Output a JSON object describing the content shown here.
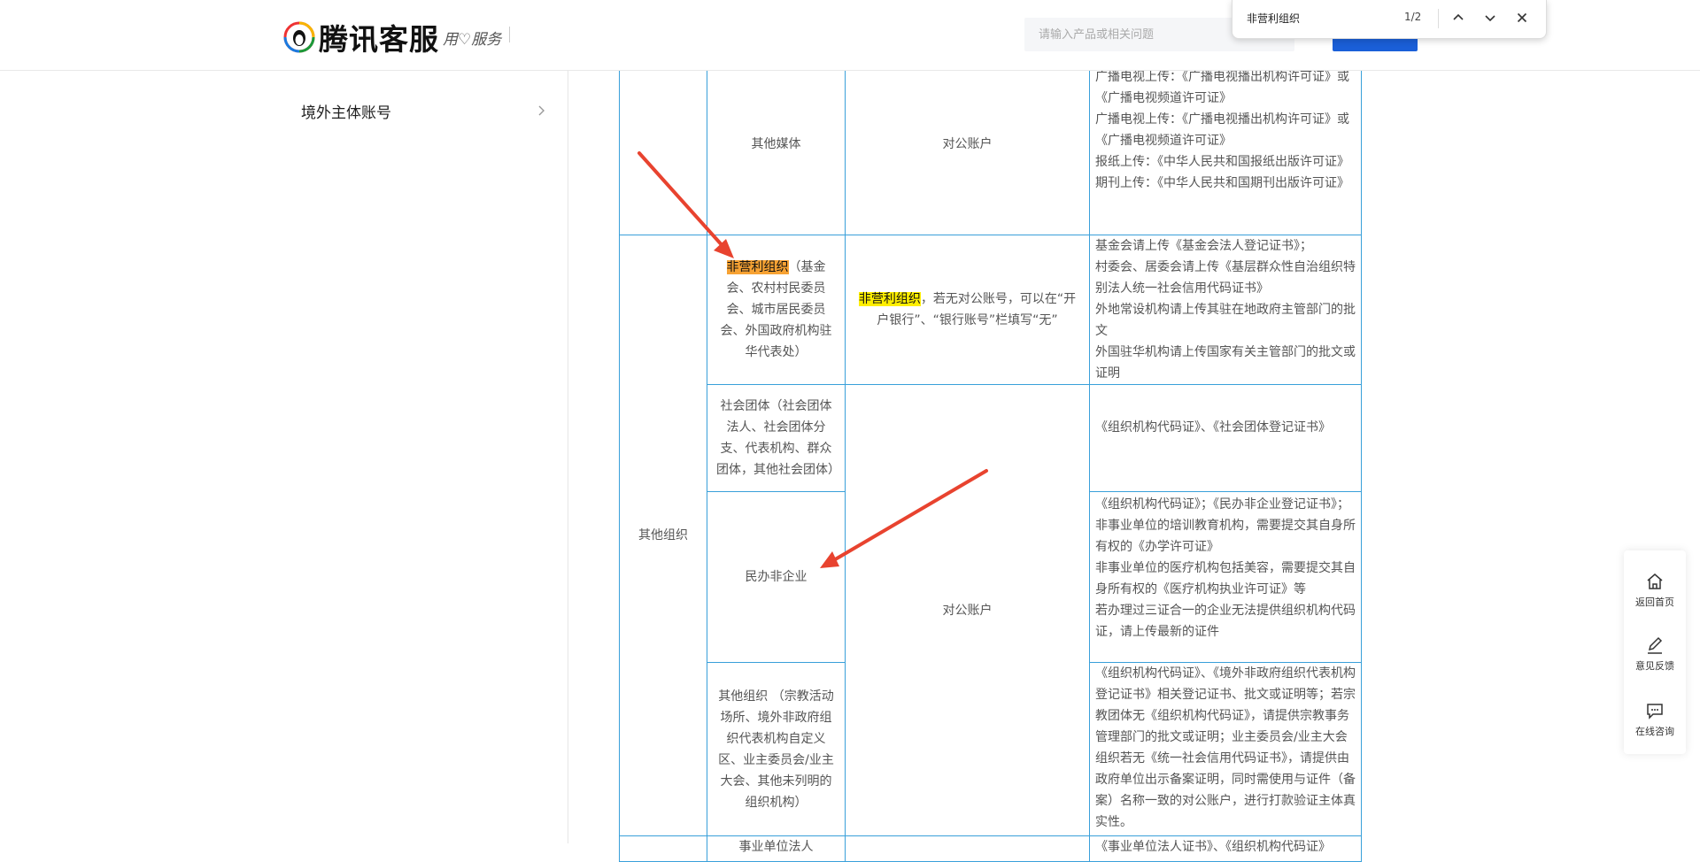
{
  "header": {
    "logo_text": "腾讯客服",
    "logo_slogan": "用♡服务",
    "search_placeholder": "请输入产品或相关问题"
  },
  "find_bar": {
    "term": "非营利组织",
    "count": "1/2"
  },
  "sidebar": {
    "items": [
      {
        "label": "境外主体账号"
      }
    ]
  },
  "table": {
    "other_media": {
      "type": "其他媒体",
      "account": "对公账户",
      "req_lines": [
        "广播电视上传：《广播电视播出机构许可证》或《广播电视频道许可证》",
        "广播电视上传：《广播电视播出机构许可证》或《广播电视频道许可证》",
        "报纸上传：《中华人民共和国报纸出版许可证》",
        "期刊上传：《中华人民共和国期刊出版许可证》"
      ]
    },
    "category": "其他组织",
    "nonprofit": {
      "highlight": "非营利组织",
      "type_rest": "（基金会、农村村民委员会、城市居民委员会、外国政府机构驻华代表处）",
      "account_highlight": "非营利组织",
      "account_rest": "，若无对公账号，可以在“开户银行”、“银行账号”栏填写“无”",
      "req_lines": [
        "基金会请上传《基金会法人登记证书》；",
        "村委会、居委会请上传《基层群众性自治组织特别法人统一社会信用代码证书》",
        "外地常设机构请上传其驻在地政府主管部门的批文",
        "外国驻华机构请上传国家有关主管部门的批文或证明"
      ]
    },
    "social": {
      "type": "社会团体（社会团体法人、社会团体分支、代表机构、群众团体，其他社会团体）",
      "req": "《组织机构代码证》、《社会团体登记证书》"
    },
    "shared_account": "对公账户",
    "private_nonenterprise": {
      "type": "民办非企业",
      "req_lines": [
        "《组织机构代码证》；《民办非企业登记证书》；",
        "非事业单位的培训教育机构，需要提交其自身所有权的《办学许可证》",
        "非事业单位的医疗机构包括美容，需要提交其自身所有权的《医疗机构执业许可证》等",
        "若办理过三证合一的企业无法提供组织机构代码证，请上传最新的证件"
      ]
    },
    "other_org": {
      "type": "其他组织 （宗教活动场所、境外非政府组织代表机构自定义区、业主委员会/业主大会、其他未列明的组织机构）",
      "req": "《组织机构代码证》、《境外非政府组织代表机构登记证书》相关登记证书、批文或证明等；若宗教团体无《组织机构代码证》，请提供宗教事务管理部门的批文或证明；业主委员会/业主大会组织若无《统一社会信用代码证书》，请提供由政府单位出示备案证明，同时需使用与证件（备案）名称一致的对公账户，进行打款验证主体真实性。"
    },
    "next_row_type": "事业单位法人",
    "next_row_req": "《事业单位法人证书》、《组织机构代码证》"
  },
  "float_panel": {
    "home": "返回首页",
    "feedback": "意见反馈",
    "chat": "在线咨询"
  },
  "colors": {
    "brand_blue": "#1a5fd8",
    "table_border": "#39a0da",
    "highlight_current": "#f7a233",
    "highlight_other": "#ffef00",
    "arrow_red": "#e8432f"
  }
}
